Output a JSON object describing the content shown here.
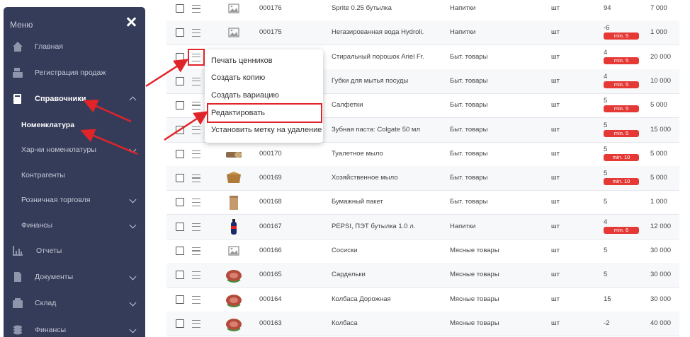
{
  "sidebar": {
    "header": "Меню",
    "items": [
      {
        "label": "Главная",
        "icon": "home-icon"
      },
      {
        "label": "Регистрация продаж",
        "icon": "cash-register-icon"
      },
      {
        "label": "Справочники",
        "icon": "book-icon"
      },
      {
        "label": "Отчеты",
        "icon": "chart-icon"
      },
      {
        "label": "Документы",
        "icon": "document-icon"
      },
      {
        "label": "Склад",
        "icon": "warehouse-icon"
      },
      {
        "label": "Финансы",
        "icon": "coins-icon"
      }
    ],
    "sub_items": [
      {
        "label": "Номенклатура"
      },
      {
        "label": "Хар-ки номенклатуры"
      },
      {
        "label": "Контрагенты"
      },
      {
        "label": "Розничная торговля"
      },
      {
        "label": "Финансы"
      }
    ]
  },
  "context_menu": {
    "items": [
      "Печать ценников",
      "Создать копию",
      "Создать вариацию",
      "Редактировать",
      "Установить метку на удаление"
    ]
  },
  "rows": [
    {
      "code": "000176",
      "name": "Sprite 0.25 бутылка",
      "category": "Напитки",
      "unit": "шт",
      "qty": "94",
      "badge": "",
      "price": "7 000"
    },
    {
      "code": "000175",
      "name": "Негазированная вода Hydroli...",
      "category": "Напитки",
      "unit": "шт",
      "qty": "-6",
      "badge": "min. 5",
      "price": "1 000"
    },
    {
      "code": "",
      "name": "Стиральный порошок Ariel Fr...",
      "category": "Быт. товары",
      "unit": "шт",
      "qty": "4",
      "badge": "min. 5",
      "price": "20 000"
    },
    {
      "code": "",
      "name": "Губки для мытья посуды",
      "category": "Быт. товары",
      "unit": "шт",
      "qty": "4",
      "badge": "min. 5",
      "price": "10 000"
    },
    {
      "code": "",
      "name": "Салфетки",
      "category": "Быт. товары",
      "unit": "шт",
      "qty": "5",
      "badge": "min. 5",
      "price": "5 000"
    },
    {
      "code": "",
      "name": "Зубная паста: Colgate 50 мл",
      "category": "Быт. товары",
      "unit": "шт",
      "qty": "5",
      "badge": "min. 5",
      "price": "15 000"
    },
    {
      "code": "000170",
      "name": "Туалетное мыло",
      "category": "Быт. товары",
      "unit": "шт",
      "qty": "5",
      "badge": "min. 10",
      "price": "5 000"
    },
    {
      "code": "000169",
      "name": "Хозяйственное мыло",
      "category": "Быт. товары",
      "unit": "шт",
      "qty": "5",
      "badge": "min. 10",
      "price": "5 000"
    },
    {
      "code": "000168",
      "name": "Бумажный пакет",
      "category": "Быт. товары",
      "unit": "шт",
      "qty": "5",
      "badge": "",
      "price": "1 000"
    },
    {
      "code": "000167",
      "name": "PEPSI, ПЭТ бутылка 1.0 л.",
      "category": "Напитки",
      "unit": "шт",
      "qty": "4",
      "badge": "min. 6",
      "price": "12 000"
    },
    {
      "code": "000166",
      "name": "Сосиски",
      "category": "Мясные товары",
      "unit": "шт",
      "qty": "5",
      "badge": "",
      "price": "30 000"
    },
    {
      "code": "000165",
      "name": "Сардельки",
      "category": "Мясные товары",
      "unit": "шт",
      "qty": "5",
      "badge": "",
      "price": "30 000"
    },
    {
      "code": "000164",
      "name": "Колбаса Дорожная",
      "category": "Мясные товары",
      "unit": "шт",
      "qty": "15",
      "badge": "",
      "price": "30 000"
    },
    {
      "code": "000163",
      "name": "Колбаса",
      "category": "Мясные товары",
      "unit": "шт",
      "qty": "-2",
      "badge": "",
      "price": "40 000"
    }
  ],
  "colors": {
    "sidebar_bg": "#353c59",
    "badge_red": "#e53935",
    "highlight_red": "#e0242a"
  }
}
